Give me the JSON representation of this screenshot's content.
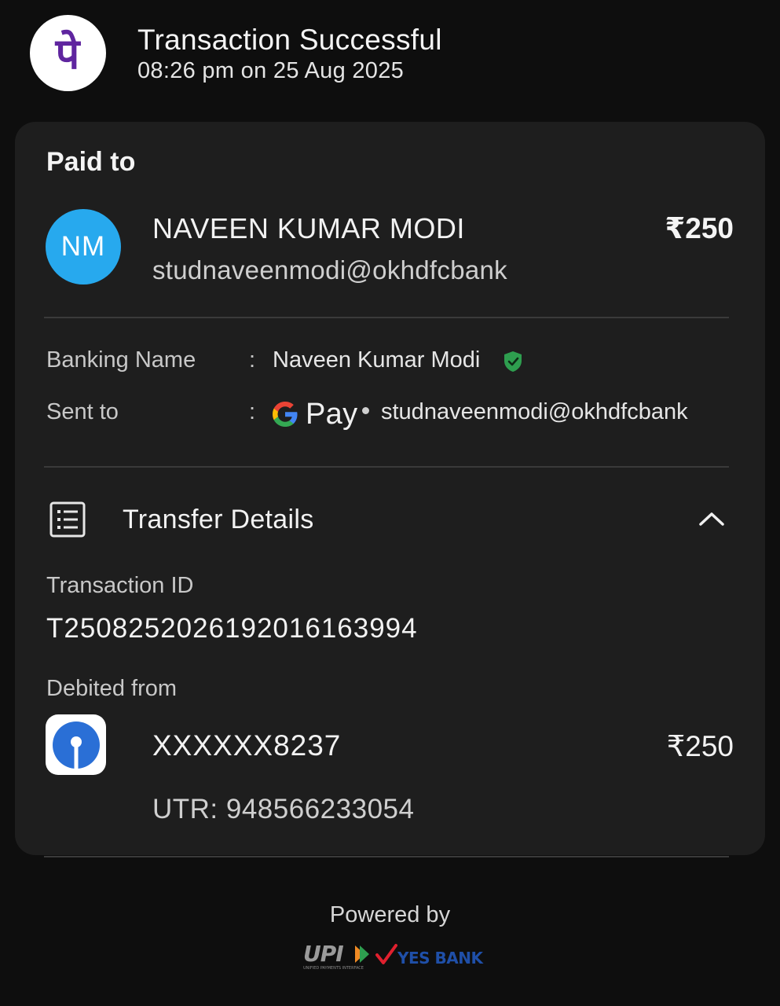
{
  "header": {
    "logo": "phonepe-logo",
    "logo_glyph": "पे",
    "title": "Transaction Successful",
    "time": "08:26 pm on 25 Aug 2025"
  },
  "payment": {
    "section_title": "Paid to",
    "avatar_initials": "NM",
    "payee_name": "NAVEEN KUMAR MODI",
    "payee_upi": "studnaveenmodi@okhdfcbank",
    "amount": "₹250"
  },
  "details": {
    "banking_name_label": "Banking Name",
    "banking_name_value": "Naveen Kumar Modi",
    "sent_to_label": "Sent to",
    "sent_to_app": "Pay",
    "sent_to_upi": "studnaveenmodi@okhdfcbank",
    "colon": ":"
  },
  "transfer": {
    "title": "Transfer Details",
    "txn_label": "Transaction ID",
    "txn_id": "T2508252026192016163994",
    "debited_label": "Debited from",
    "account": "XXXXXX8237",
    "amount": "₹250",
    "utr": "UTR: 948566233054"
  },
  "footer": {
    "powered_by": "Powered by",
    "upi_text": "UPI",
    "bank_text": "YES BANK",
    "upi_subtext": "UNIFIED PAYMENTS INTERFACE"
  },
  "colors": {
    "background": "#0e0e0e",
    "card": "#1e1e1e",
    "avatar": "#27a9ee",
    "phonepe_purple": "#5f259f",
    "verified_green": "#2e9e4f",
    "sbi_blue": "#2a6fd6",
    "yes_bank_blue": "#1f4fa8",
    "yes_bank_red": "#e0202e"
  }
}
